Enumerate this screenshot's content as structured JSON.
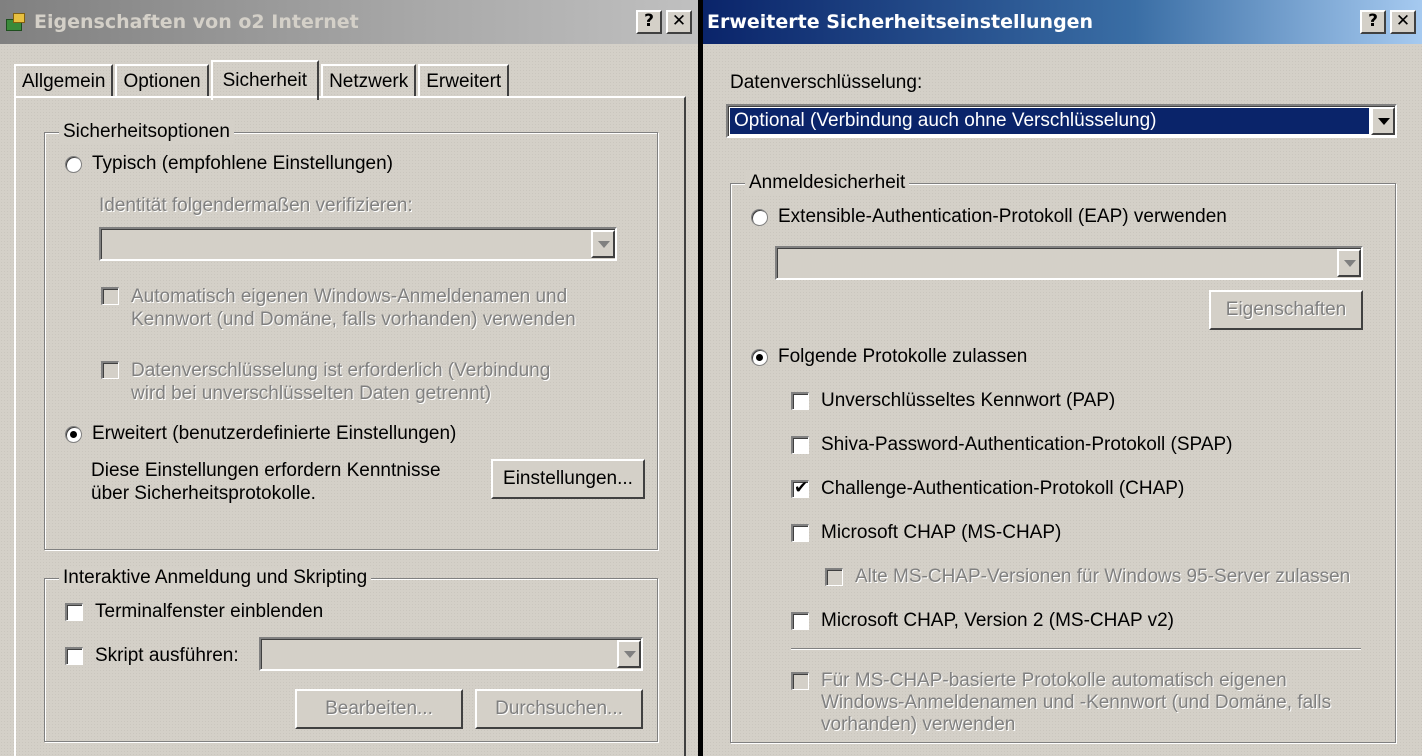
{
  "left_dialog": {
    "title": "Eigenschaften von o2 Internet",
    "help_btn": "?",
    "close_btn": "✕",
    "tabs": [
      "Allgemein",
      "Optionen",
      "Sicherheit",
      "Netzwerk",
      "Erweitert"
    ],
    "security_group": {
      "label": "Sicherheitsoptionen",
      "typical_radio": "Typisch (empfohlene Einstellungen)",
      "verify_label": "Identität folgendermaßen verifizieren:",
      "verify_combo_value": "",
      "auto_logon_line1": "Automatisch eigenen Windows-Anmeldenamen und",
      "auto_logon_line2": "Kennwort (und Domäne, falls vorhanden) verwenden",
      "encryption_line1": "Datenverschlüsselung ist erforderlich (Verbindung",
      "encryption_line2": "wird bei unverschlüsselten Daten getrennt)",
      "advanced_radio": "Erweitert (benutzerdefinierte Einstellungen)",
      "advanced_note_line1": "Diese Einstellungen erfordern Kenntnisse",
      "advanced_note_line2": "über Sicherheitsprotokolle.",
      "settings_button": "Einstellungen..."
    },
    "interactive_group": {
      "label": "Interaktive Anmeldung und Skripting",
      "terminal_check": "Terminalfenster einblenden",
      "script_check": "Skript ausführen:",
      "script_combo_value": "",
      "edit_button": "Bearbeiten...",
      "browse_button": "Durchsuchen..."
    }
  },
  "right_dialog": {
    "title": "Erweiterte Sicherheitseinstellungen",
    "help_btn": "?",
    "close_btn": "✕",
    "encryption_label": "Datenverschlüsselung:",
    "encryption_value": "Optional (Verbindung auch ohne Verschlüsselung)",
    "logon_group": {
      "label": "Anmeldesicherheit",
      "eap_radio": "Extensible-Authentication-Protokoll (EAP) verwenden",
      "eap_combo_value": "",
      "properties_button": "Eigenschaften",
      "allow_radio": "Folgende Protokolle zulassen",
      "pap": "Unverschlüsseltes Kennwort (PAP)",
      "spap": "Shiva-Password-Authentication-Protokoll (SPAP)",
      "chap": "Challenge-Authentication-Protokoll (CHAP)",
      "mschap": "Microsoft CHAP (MS-CHAP)",
      "mschap_old": "Alte MS-CHAP-Versionen für Windows 95-Server zulassen",
      "mschap_v2": "Microsoft CHAP, Version 2 (MS-CHAP v2)",
      "auto_line1": "Für MS-CHAP-basierte Protokolle automatisch eigenen",
      "auto_line2": "Windows-Anmeldenamen und -Kennwort (und Domäne, falls",
      "auto_line3": "vorhanden) verwenden"
    }
  },
  "checkmark": "✔"
}
